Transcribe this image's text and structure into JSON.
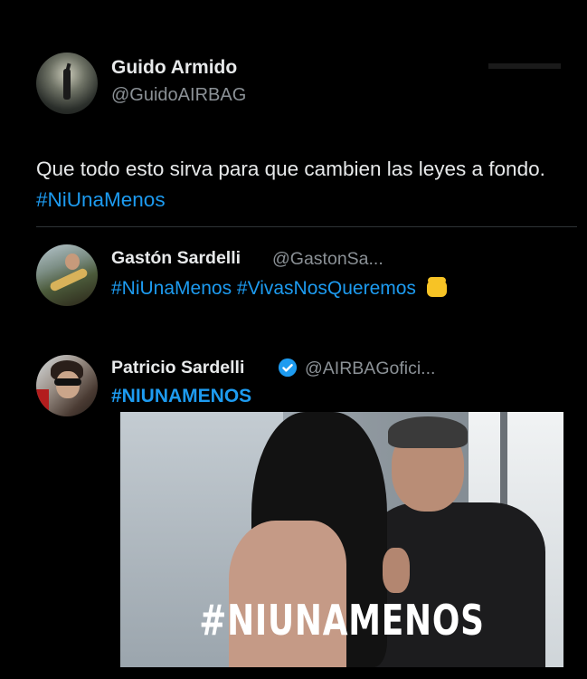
{
  "main_tweet": {
    "name": "Guido Armido",
    "handle": "@GuidoAIRBAG",
    "text": "Que todo esto sirva para que cambien las leyes a fondo.",
    "hashtag": "#NiUnaMenos"
  },
  "reply_gaston": {
    "name": "Gastón Sardelli",
    "handle": "@GastonSa...",
    "hashtags": "#NiUnaMenos #VivasNosQueremos",
    "emoji": "fist-icon"
  },
  "reply_patricio": {
    "name": "Patricio Sardelli",
    "handle": "@AIRBAGofici...",
    "verified": true,
    "hashtag": "#NIUNAMENOS",
    "media_caption": "#NIUNAMENOS"
  },
  "colors": {
    "background": "#000000",
    "text": "#e7e9ea",
    "secondary": "#8b9196",
    "link": "#1d9bf0",
    "verified": "#1d9bf0"
  }
}
